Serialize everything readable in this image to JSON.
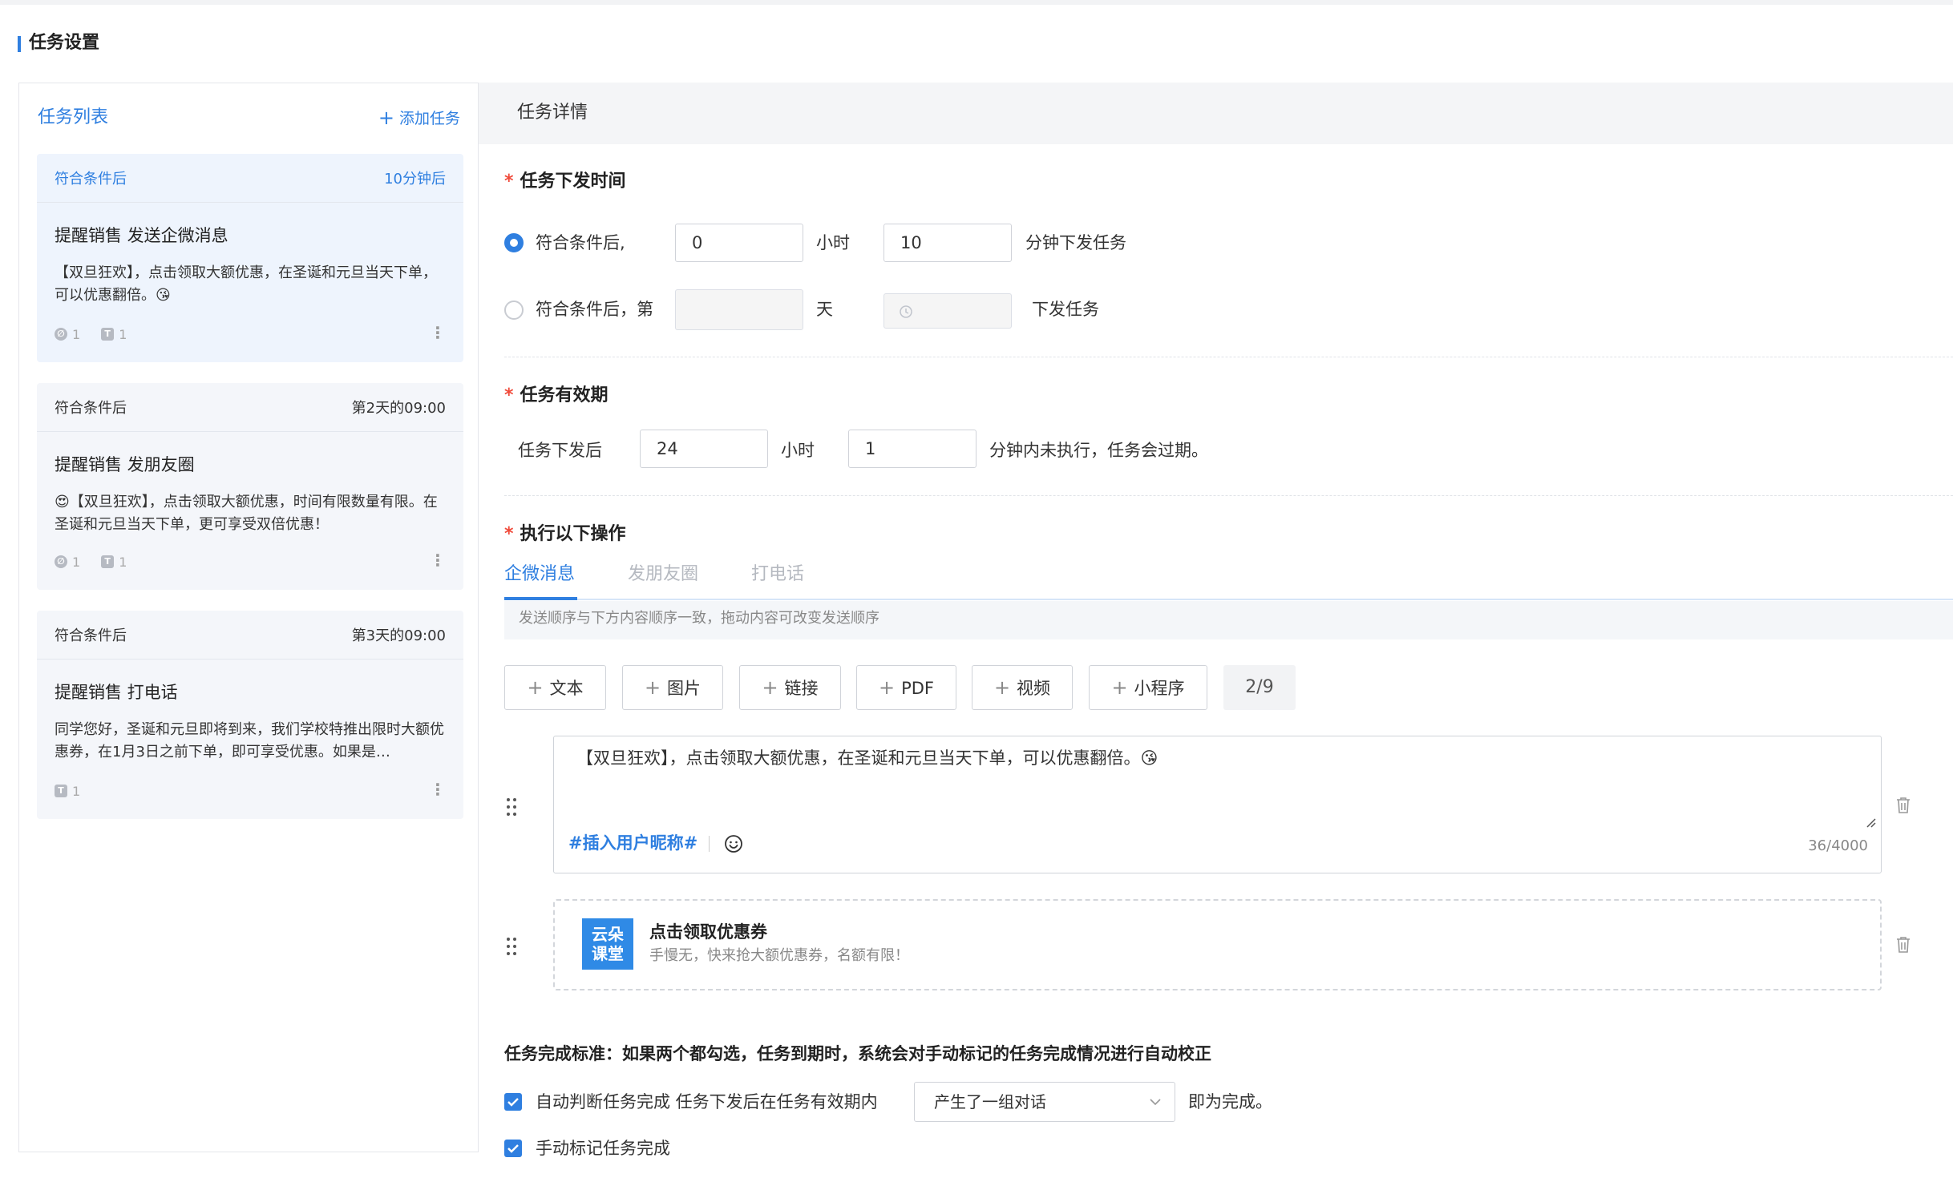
{
  "page": {
    "title": "任务设置"
  },
  "task_list": {
    "title": "任务列表",
    "add_label": "添加任务",
    "cards": [
      {
        "condition": "符合条件后",
        "timing": "10分钟后",
        "title": "提醒销售 发送企微消息",
        "desc": "【双旦狂欢】，点击领取大额优惠，在圣诞和元旦当天下单，可以优惠翻倍。😘",
        "link_count": "1",
        "text_count": "1"
      },
      {
        "condition": "符合条件后",
        "timing": "第2天的09:00",
        "title": "提醒销售 发朋友圈",
        "desc": "😍【双旦狂欢】，点击领取大额优惠，时间有限数量有限。在圣诞和元旦当天下单，更可享受双倍优惠！",
        "link_count": "1",
        "text_count": "1"
      },
      {
        "condition": "符合条件后",
        "timing": "第3天的09:00",
        "title": "提醒销售 打电话",
        "desc": "同学您好，圣诞和元旦即将到来，我们学校特推出限时大额优惠券，在1月3日之前下单，即可享受优惠。如果是…",
        "text_count": "1"
      }
    ]
  },
  "detail": {
    "header": "任务详情",
    "dispatch": {
      "title": "任务下发时间",
      "opt1_label": "符合条件后,",
      "opt1_hours": "0",
      "hours_unit": "小时",
      "opt1_minutes": "10",
      "opt1_suffix": "分钟下发任务",
      "opt2_label": "符合条件后，第",
      "day_unit": "天",
      "opt2_suffix": "下发任务"
    },
    "validity": {
      "title": "任务有效期",
      "prefix": "任务下发后",
      "hours": "24",
      "hours_unit": "小时",
      "minutes": "1",
      "suffix": "分钟内未执行，任务会过期。"
    },
    "actions": {
      "title": "执行以下操作",
      "tabs": [
        "企微消息",
        "发朋友圈",
        "打电话"
      ],
      "hint": "发送顺序与下方内容顺序一致，拖动内容可改变发送顺序",
      "buttons": [
        "文本",
        "图片",
        "链接",
        "PDF",
        "视频",
        "小程序"
      ],
      "count": "2/9",
      "message": {
        "text": "【双旦狂欢】，点击领取大额优惠，在圣诞和元旦当天下单，可以优惠翻倍。😘",
        "insert_label": "#插入用户昵称#",
        "char_count": "36/4000"
      },
      "link": {
        "logo_line1": "云朵",
        "logo_line2": "课堂",
        "title": "点击领取优惠券",
        "desc": "手慢无，快来抢大额优惠券，名额有限！"
      }
    },
    "completion": {
      "title": "任务完成标准：如果两个都勾选，任务到期时，系统会对手动标记的任务完成情况进行自动校正",
      "auto_label": "自动判断任务完成 任务下发后在任务有效期内",
      "auto_select": "产生了一组对话",
      "auto_suffix": "即为完成。",
      "manual_label": "手动标记任务完成"
    }
  },
  "colors": {
    "accent": "#2f7fe0",
    "required": "#f04a3a"
  }
}
